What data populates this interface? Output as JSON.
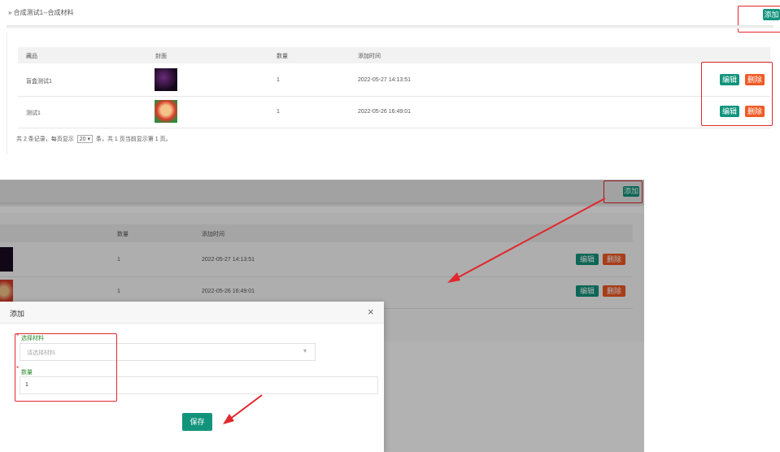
{
  "top": {
    "breadcrumb": "» 合成测试1--合成材料",
    "add_label": "添加",
    "headers": [
      "藏品",
      "封面",
      "数量",
      "添加时间"
    ],
    "rows": [
      {
        "name": "盲盒测试1",
        "qty": "1",
        "time": "2022-05-27 14:13:51",
        "edit": "编辑",
        "delete": "删除"
      },
      {
        "name": "测试1",
        "qty": "1",
        "time": "2022-05-26 16:49:01",
        "edit": "编辑",
        "delete": "删除"
      }
    ],
    "pagination": {
      "prefix": "共 2 条记录，每页显示",
      "page_size": "20",
      "suffix": "条，共 1 页当前显示第 1 页。"
    }
  },
  "bottom": {
    "add_label": "添加",
    "headers": [
      "数量",
      "添加时间"
    ],
    "rows": [
      {
        "qty": "1",
        "time": "2022-05-27 14:13:51",
        "edit": "编辑",
        "delete": "删除"
      },
      {
        "qty": "1",
        "time": "2022-05-26 16:49:01",
        "edit": "编辑",
        "delete": "删除"
      }
    ]
  },
  "modal": {
    "title": "添加",
    "close": "×",
    "material_label": "选择材料",
    "material_placeholder": "请选择材料",
    "qty_label": "数量",
    "qty_value": "1",
    "save_label": "保存"
  },
  "colors": {
    "primary": "#12947c",
    "danger": "#f05a25",
    "annotation": "#e0282d"
  }
}
